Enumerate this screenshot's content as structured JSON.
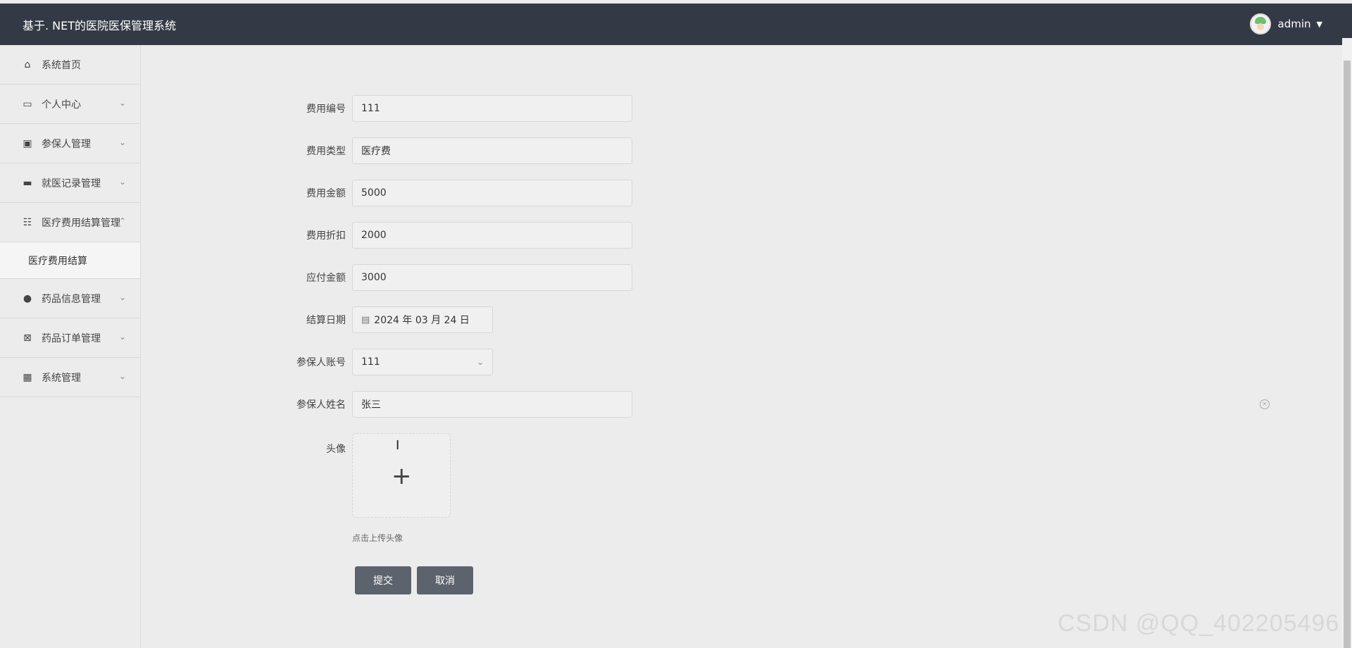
{
  "app": {
    "title": "基于. NET的医院医保管理系统",
    "user": "admin"
  },
  "sidebar": {
    "items": [
      {
        "label": "系统首页",
        "icon": "home-icon"
      },
      {
        "label": "个人中心",
        "icon": "card-icon"
      },
      {
        "label": "参保人管理",
        "icon": "clipboard-icon"
      },
      {
        "label": "就医记录管理",
        "icon": "monitor-icon"
      },
      {
        "label": "医疗费用结算管理",
        "icon": "sliders-icon"
      },
      {
        "label": "药品信息管理",
        "icon": "person-icon"
      },
      {
        "label": "药品订单管理",
        "icon": "clipboard-x-icon"
      },
      {
        "label": "系统管理",
        "icon": "grid-icon"
      }
    ],
    "submenu": {
      "label": "医疗费用结算"
    }
  },
  "form": {
    "fee_number": {
      "label": "费用编号",
      "value": "111"
    },
    "fee_type": {
      "label": "费用类型",
      "value": "医疗费"
    },
    "fee_amount": {
      "label": "费用金额",
      "value": "5000"
    },
    "fee_discount": {
      "label": "费用折扣",
      "value": "2000"
    },
    "payable_amount": {
      "label": "应付金额",
      "value": "3000"
    },
    "settlement_date": {
      "label": "结算日期",
      "value": "2024 年 03 月 24 日"
    },
    "insured_account": {
      "label": "参保人账号",
      "value": "111"
    },
    "insured_name": {
      "label": "参保人姓名",
      "value": "张三"
    },
    "avatar": {
      "label": "头像",
      "hint": "点击上传头像"
    },
    "submit": "提交",
    "cancel": "取消"
  },
  "watermark": "CSDN @QQ_402205496"
}
